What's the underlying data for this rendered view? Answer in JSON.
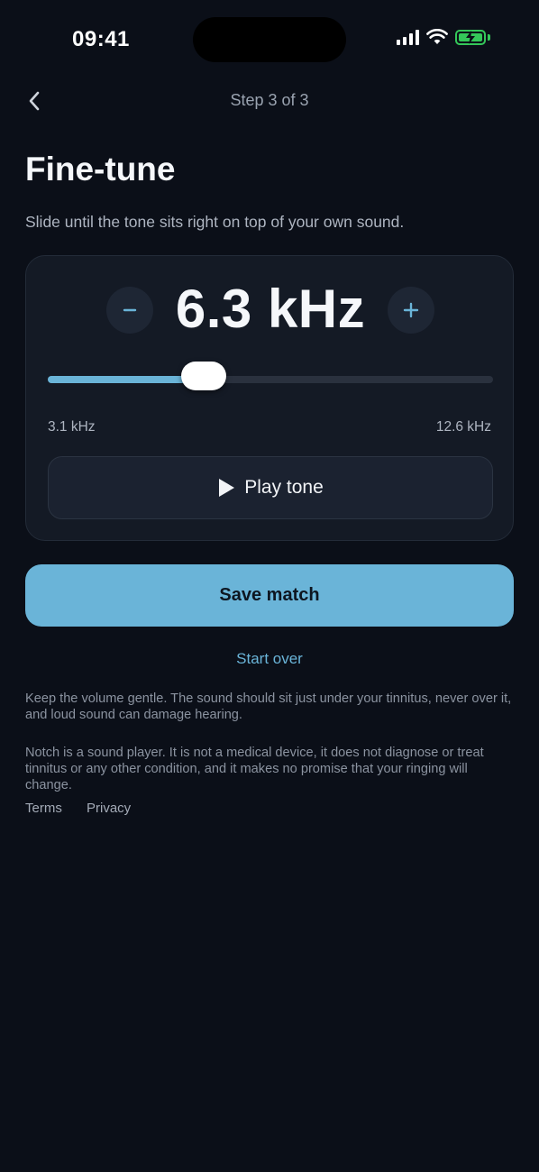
{
  "status": {
    "time": "09:41"
  },
  "header": {
    "step": "Step 3 of 3",
    "back_icon": "chevron-left-icon"
  },
  "page": {
    "title": "Fine-tune",
    "subtitle": "Slide until the tone sits right on top of your own sound."
  },
  "tuner": {
    "value": "6.3 kHz",
    "min_label": "3.1 kHz",
    "max_label": "12.6 kHz",
    "slider_fraction": 0.35,
    "play_label": "Play tone"
  },
  "actions": {
    "save_label": "Save match",
    "start_over_label": "Start over"
  },
  "notices": {
    "volume": "Keep the volume gentle. The sound should sit just under your tinnitus, never over it, and loud sound can damage hearing.",
    "disclaimer": "Notch is a sound player. It is not a medical device, it does not diagnose or treat tinnitus or any other condition, and it makes no promise that your ringing will change."
  },
  "footer": {
    "terms": "Terms",
    "privacy": "Privacy"
  },
  "colors": {
    "accent": "#6ab4d8",
    "background": "#0b0f18",
    "card": "#141a25",
    "battery": "#34c759"
  }
}
